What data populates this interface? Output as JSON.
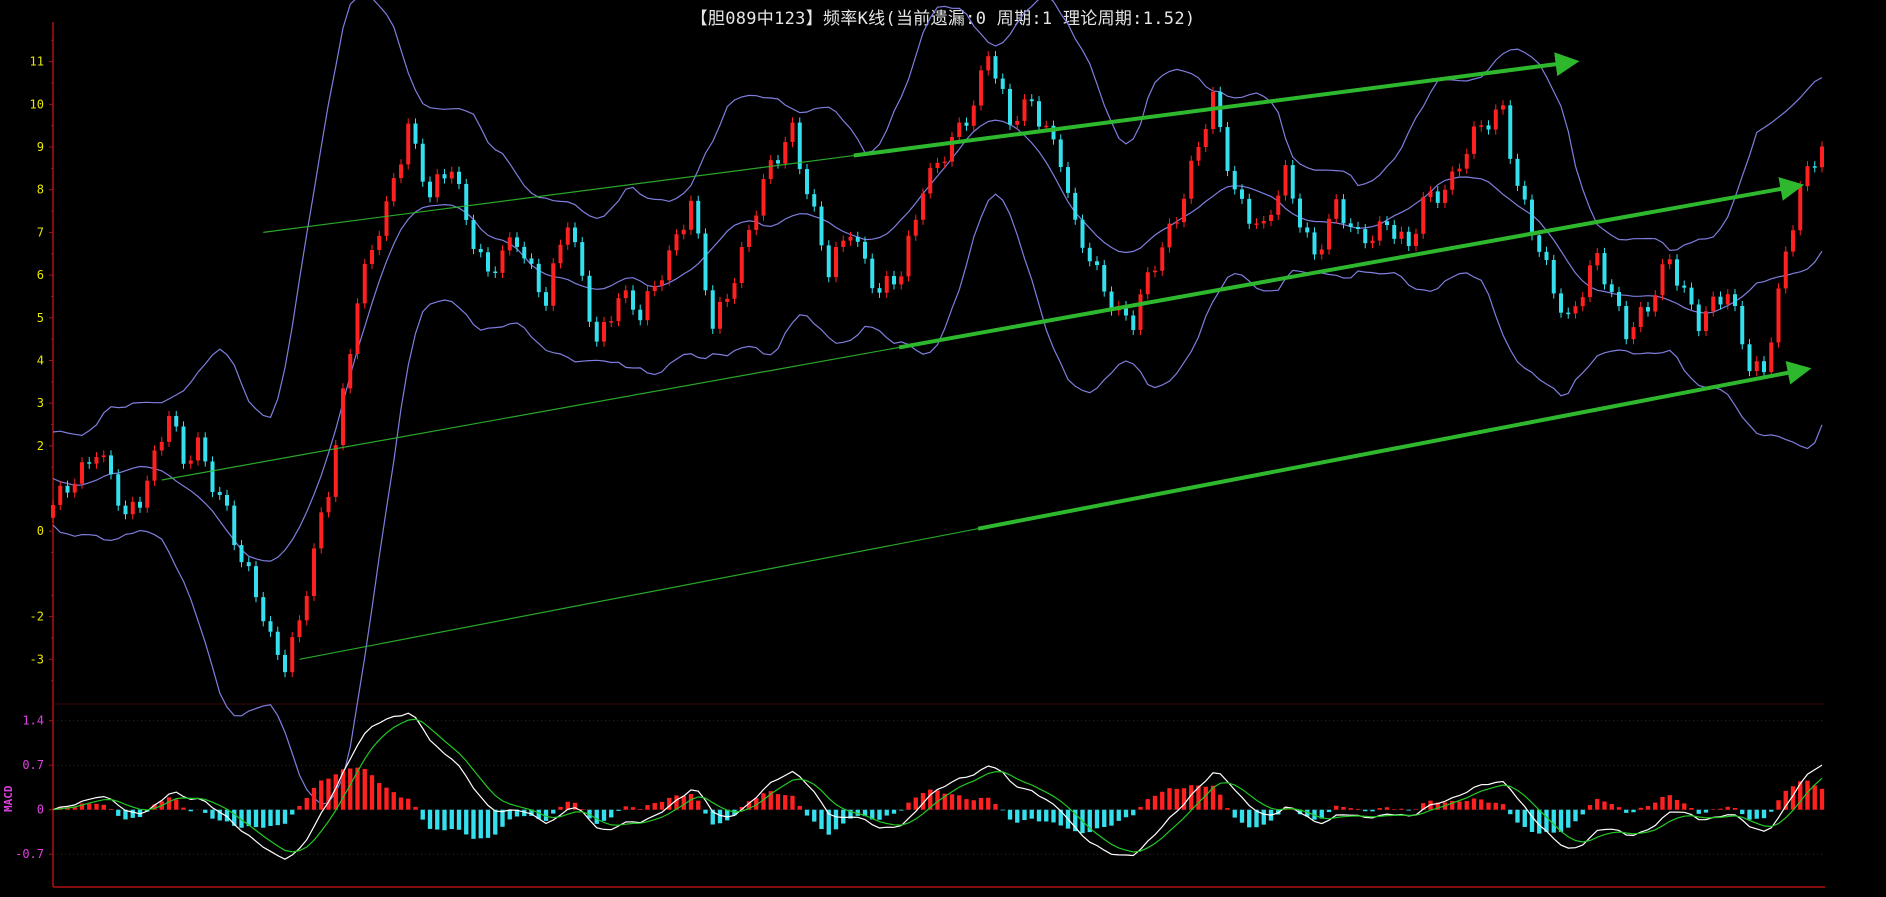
{
  "chart_data": [
    {
      "type": "candlestick",
      "title": "【胆089中123】频率K线(当前遗漏:0 周期:1 理论周期:1.52)",
      "ylim": [
        -4.0,
        11.6
      ],
      "y_ticks": [
        {
          "v": 11,
          "label": "11"
        },
        {
          "v": 10,
          "label": "10"
        },
        {
          "v": 9,
          "label": "9"
        },
        {
          "v": 8,
          "label": "8"
        },
        {
          "v": 7,
          "label": "7"
        },
        {
          "v": 6,
          "label": "6"
        },
        {
          "v": 5,
          "label": "5"
        },
        {
          "v": 4,
          "label": "4"
        },
        {
          "v": 3,
          "label": "3"
        },
        {
          "v": 2,
          "label": "2"
        },
        {
          "v": 0,
          "label": "0"
        },
        {
          "v": -2,
          "label": "-2"
        },
        {
          "v": -3,
          "label": "-3"
        }
      ],
      "x_count": 245,
      "close_anchors": [
        [
          0,
          0.5
        ],
        [
          6,
          2.0
        ],
        [
          8,
          1.2
        ],
        [
          10,
          0.2
        ],
        [
          12,
          0.8
        ],
        [
          16,
          2.8
        ],
        [
          18,
          1.5
        ],
        [
          20,
          2.0
        ],
        [
          24,
          0.5
        ],
        [
          26,
          -0.8
        ],
        [
          28,
          -1.5
        ],
        [
          30,
          -2.5
        ],
        [
          32,
          -3.0
        ],
        [
          34,
          -2.2
        ],
        [
          38,
          1.0
        ],
        [
          42,
          5.5
        ],
        [
          46,
          7.5
        ],
        [
          49,
          9.6
        ],
        [
          52,
          7.8
        ],
        [
          55,
          8.5
        ],
        [
          57,
          7.4
        ],
        [
          60,
          6.0
        ],
        [
          64,
          6.8
        ],
        [
          68,
          5.5
        ],
        [
          71,
          7.2
        ],
        [
          75,
          4.5
        ],
        [
          78,
          5.5
        ],
        [
          81,
          5.0
        ],
        [
          84,
          6.2
        ],
        [
          88,
          7.6
        ],
        [
          91,
          4.8
        ],
        [
          95,
          6.5
        ],
        [
          99,
          8.5
        ],
        [
          102,
          9.5
        ],
        [
          104,
          8.0
        ],
        [
          107,
          6.0
        ],
        [
          110,
          7.2
        ],
        [
          114,
          5.5
        ],
        [
          117,
          6.0
        ],
        [
          120,
          8.2
        ],
        [
          124,
          9.0
        ],
        [
          127,
          10.0
        ],
        [
          129,
          11.4
        ],
        [
          132,
          9.5
        ],
        [
          135,
          10.0
        ],
        [
          137,
          9.5
        ],
        [
          139,
          8.8
        ],
        [
          141,
          7.0
        ],
        [
          144,
          6.0
        ],
        [
          147,
          5.2
        ],
        [
          149,
          4.9
        ],
        [
          151,
          5.8
        ],
        [
          155,
          7.5
        ],
        [
          160,
          10.0
        ],
        [
          163,
          8.0
        ],
        [
          167,
          7.0
        ],
        [
          170,
          8.3
        ],
        [
          174,
          6.5
        ],
        [
          177,
          7.5
        ],
        [
          180,
          6.9
        ],
        [
          184,
          7.2
        ],
        [
          187,
          6.5
        ],
        [
          189,
          7.8
        ],
        [
          193,
          8.2
        ],
        [
          197,
          9.5
        ],
        [
          200,
          10.0
        ],
        [
          202,
          8.0
        ],
        [
          205,
          6.5
        ],
        [
          209,
          5.0
        ],
        [
          213,
          6.3
        ],
        [
          217,
          4.8
        ],
        [
          220,
          5.2
        ],
        [
          223,
          6.3
        ],
        [
          227,
          5.0
        ],
        [
          231,
          5.5
        ],
        [
          234,
          4.0
        ],
        [
          236,
          3.8
        ],
        [
          241,
          8.0
        ],
        [
          244,
          9.2
        ]
      ],
      "band_colour": "#7e7ede",
      "up_colour": "#ff2020",
      "down_colour": "#35e0ee",
      "trend_lines": [
        {
          "from": [
            29,
            7.0
          ],
          "to": [
            210,
            11.0
          ],
          "arrow": true
        },
        {
          "from": [
            15,
            1.2
          ],
          "to": [
            241,
            8.1
          ],
          "arrow": true
        },
        {
          "from": [
            34,
            -3.0
          ],
          "to": [
            242,
            3.8
          ],
          "arrow": true
        }
      ],
      "trend_colour": "#2eb82e"
    },
    {
      "type": "macd",
      "label": "MACD",
      "ylim": [
        -1.2,
        1.6
      ],
      "y_ticks": [
        {
          "v": 1.4,
          "label": "1.4"
        },
        {
          "v": 0.7,
          "label": "0.7"
        },
        {
          "v": 0,
          "label": "0"
        },
        {
          "v": -0.7,
          "label": "-0.7"
        }
      ],
      "dif_colour": "#ffffff",
      "dea_colour": "#23c723",
      "hist_up_colour": "#ff2020",
      "hist_down_colour": "#35e0ee"
    }
  ]
}
